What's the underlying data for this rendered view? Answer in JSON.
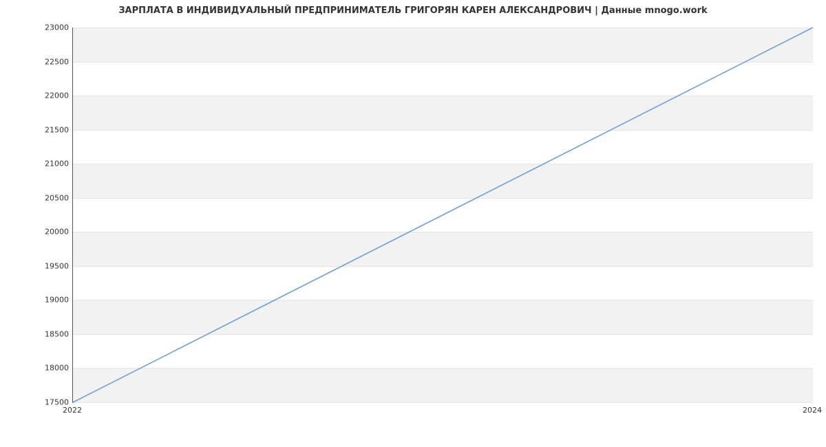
{
  "chart_data": {
    "type": "line",
    "title": "ЗАРПЛАТА В ИНДИВИДУАЛЬНЫЙ ПРЕДПРИНИМАТЕЛЬ ГРИГОРЯН КАРЕН АЛЕКСАНДРОВИЧ | Данные mnogo.work",
    "x": [
      2022,
      2024
    ],
    "values": [
      17500,
      23000
    ],
    "xlabel": "",
    "ylabel": "",
    "xticks": [
      2022,
      2024
    ],
    "yticks": [
      17500,
      18000,
      18500,
      19000,
      19500,
      20000,
      20500,
      21000,
      21500,
      22000,
      22500,
      23000
    ],
    "ylim": [
      17500,
      23000
    ],
    "xlim": [
      2022,
      2024
    ],
    "line_color": "#6f9fdc"
  }
}
